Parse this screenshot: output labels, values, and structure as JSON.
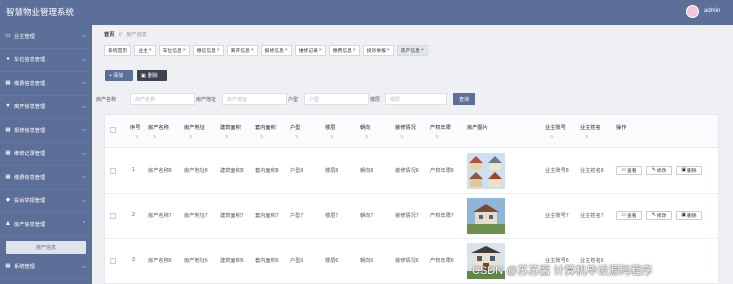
{
  "app": {
    "title": "智慧物业管理系统",
    "user": "admin"
  },
  "sidebar": {
    "items": [
      {
        "label": "业主管理",
        "icon": "monitor-icon"
      },
      {
        "label": "车位信息管理",
        "icon": "location-icon"
      },
      {
        "label": "缴费信息管理",
        "icon": "grid-icon"
      },
      {
        "label": "离开信息管理",
        "icon": "trophy-icon"
      },
      {
        "label": "报修信息管理",
        "icon": "grid-icon"
      },
      {
        "label": "维修记录管理",
        "icon": "grid-icon"
      },
      {
        "label": "缴费信息管理",
        "icon": "grid-icon"
      },
      {
        "label": "投诉举报管理",
        "icon": "bell-icon"
      },
      {
        "label": "房产信息管理",
        "icon": "user-icon"
      }
    ],
    "sub_item": "房产信息",
    "last_item": {
      "label": "系统管理",
      "icon": "grid-icon"
    }
  },
  "breadcrumb": {
    "home": "首页",
    "sep": "//",
    "current": "房产信息"
  },
  "tabs": [
    "系统首页",
    "业主",
    "车位信息",
    "缴信信息",
    "离开信息",
    "报修信息",
    "维修记录",
    "缴费信息",
    "投诉举报",
    "房产信息"
  ],
  "toolbar": {
    "add": "+ 添加",
    "delete": "删除"
  },
  "search": {
    "fields": [
      {
        "label": "房产名称",
        "placeholder": "房产名称"
      },
      {
        "label": "房产地址",
        "placeholder": "房产地址"
      },
      {
        "label": "户型",
        "placeholder": "户型"
      },
      {
        "label": "楼层",
        "placeholder": "楼层"
      }
    ],
    "button": "查询"
  },
  "table": {
    "headers": [
      "序号",
      "房产名称",
      "房产地址",
      "建筑面积",
      "套内面积",
      "户型",
      "楼层",
      "朝向",
      "装修情况",
      "产权年限",
      "房产图片",
      "业主账号",
      "业主姓名",
      "操作"
    ],
    "rows": [
      {
        "no": "1",
        "name": "房产名称8",
        "addr": "房产地址8",
        "area": "建筑面积8",
        "inner": "套内面积8",
        "type": "户型8",
        "floor": "楼层8",
        "dir": "朝向8",
        "deco": "装修情况8",
        "years": "产权年限8",
        "acct": "业主账号8",
        "owner": "业主姓名8"
      },
      {
        "no": "2",
        "name": "房产名称7",
        "addr": "房产地址7",
        "area": "建筑面积7",
        "inner": "套内面积7",
        "type": "户型7",
        "floor": "楼层7",
        "dir": "朝向7",
        "deco": "装修情况7",
        "years": "产权年限7",
        "acct": "业主账号7",
        "owner": "业主姓名7"
      },
      {
        "no": "3",
        "name": "房产名称6",
        "addr": "房产地址6",
        "area": "建筑面积6",
        "inner": "套内面积6",
        "type": "户型6",
        "floor": "楼层6",
        "dir": "朝向6",
        "deco": "装修情况6",
        "years": "产权年限6",
        "acct": "业主账号6",
        "owner": "业主姓名6"
      }
    ],
    "actions": {
      "view": "查看",
      "edit": "修改",
      "delete": "删除"
    }
  },
  "watermark": "CSDN @苏苏酱  计算机毕设源码程序",
  "colors": {
    "primary": "#5c6f98",
    "dark_button": "#3f4350"
  }
}
